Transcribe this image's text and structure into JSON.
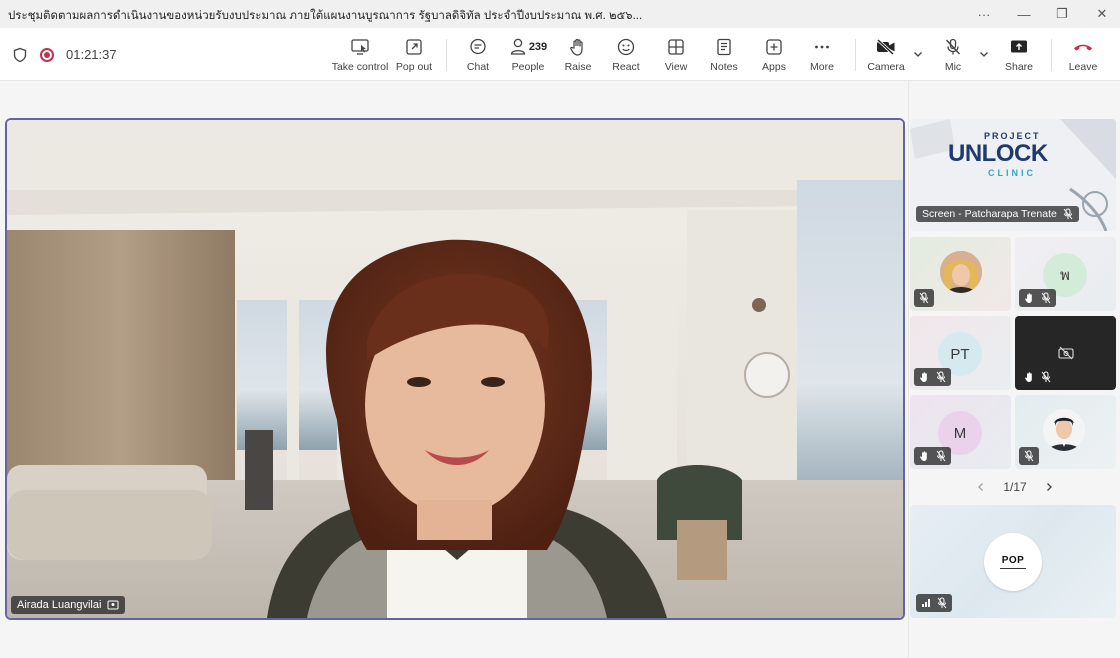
{
  "window": {
    "title": "ประชุมติดตามผลการดำเนินงานของหน่วยรับงบประมาณ ภายใต้แผนงานบูรณาการ รัฐบาลดิจิทัล ประจำปีงบประมาณ พ.ศ. ๒๕๖...",
    "more": "···",
    "minimize": "—",
    "restore": "❐",
    "close": "✕"
  },
  "toolbar": {
    "timer": "01:21:37",
    "take_control": "Take control",
    "pop_out": "Pop out",
    "chat": "Chat",
    "people": "People",
    "people_count": "239",
    "raise": "Raise",
    "react": "React",
    "view": "View",
    "notes": "Notes",
    "apps": "Apps",
    "more": "More",
    "camera": "Camera",
    "mic": "Mic",
    "share": "Share",
    "leave": "Leave",
    "leave_color": "#c4314b",
    "record_color": "#c4314b"
  },
  "main_video": {
    "speaker_name": "Airada Luangvilai",
    "border_color": "#6264a7"
  },
  "panel": {
    "screen_share": {
      "label": "Screen - Patcharapa Trenate",
      "project_title": "PROJECT",
      "unlock": "UNLOCK",
      "clinic": "CLINIC"
    },
    "tiles": [
      {
        "initials": "",
        "kind": "photo"
      },
      {
        "initials": "พ",
        "kind": "initials"
      },
      {
        "initials": "PT",
        "kind": "initials"
      },
      {
        "initials": "",
        "kind": "camera-off"
      },
      {
        "initials": "M",
        "kind": "initials"
      },
      {
        "initials": "",
        "kind": "photo"
      }
    ],
    "pager": "1/17",
    "pop_tile": {
      "logo_text": "POP"
    }
  }
}
